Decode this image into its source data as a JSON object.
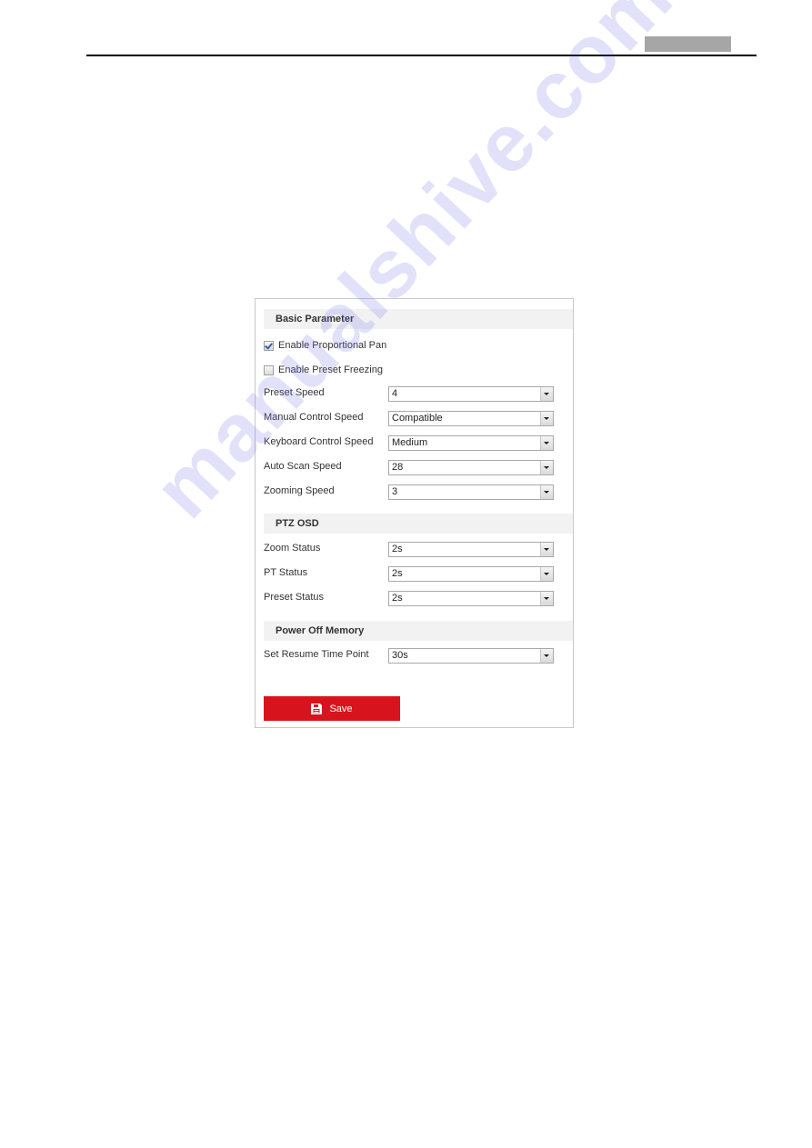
{
  "page": {
    "watermark": "manualshive.com"
  },
  "panel": {
    "sections": {
      "basic": "Basic Parameter",
      "osd": "PTZ OSD",
      "power": "Power Off Memory"
    },
    "checkboxes": [
      {
        "label": "Enable Proportional Pan",
        "checked": true
      },
      {
        "label": "Enable Preset Freezing",
        "checked": false
      }
    ],
    "basic_fields": [
      {
        "label": "Preset Speed",
        "value": "4"
      },
      {
        "label": "Manual Control Speed",
        "value": "Compatible"
      },
      {
        "label": "Keyboard Control Speed",
        "value": "Medium"
      },
      {
        "label": "Auto Scan Speed",
        "value": "28"
      },
      {
        "label": "Zooming Speed",
        "value": "3"
      }
    ],
    "osd_fields": [
      {
        "label": "Zoom Status",
        "value": "2s"
      },
      {
        "label": "PT Status",
        "value": "2s"
      },
      {
        "label": "Preset Status",
        "value": "2s"
      }
    ],
    "power_fields": [
      {
        "label": "Set Resume Time Point",
        "value": "30s"
      }
    ],
    "save_label": "Save",
    "save_color": "#d7141d"
  }
}
